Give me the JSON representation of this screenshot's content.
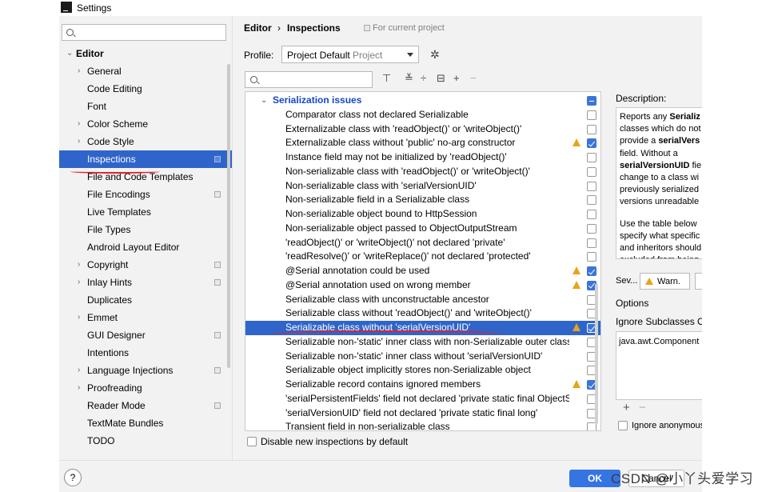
{
  "window": {
    "title": "Settings"
  },
  "sidebar": {
    "search_placeholder": "",
    "items": [
      {
        "label": "Editor",
        "expanded": true,
        "arrow": "open",
        "level": 0,
        "project": false
      },
      {
        "label": "General",
        "arrow": "closed",
        "level": 1,
        "project": false
      },
      {
        "label": "Code Editing",
        "arrow": "none",
        "level": 1,
        "project": false
      },
      {
        "label": "Font",
        "arrow": "none",
        "level": 1,
        "project": false
      },
      {
        "label": "Color Scheme",
        "arrow": "closed",
        "level": 1,
        "project": false
      },
      {
        "label": "Code Style",
        "arrow": "closed",
        "level": 1,
        "project": false
      },
      {
        "label": "Inspections",
        "arrow": "none",
        "level": 1,
        "project": true,
        "selected": true
      },
      {
        "label": "File and Code Templates",
        "arrow": "none",
        "level": 1,
        "project": false
      },
      {
        "label": "File Encodings",
        "arrow": "none",
        "level": 1,
        "project": true
      },
      {
        "label": "Live Templates",
        "arrow": "none",
        "level": 1,
        "project": false
      },
      {
        "label": "File Types",
        "arrow": "none",
        "level": 1,
        "project": false
      },
      {
        "label": "Android Layout Editor",
        "arrow": "none",
        "level": 1,
        "project": false
      },
      {
        "label": "Copyright",
        "arrow": "closed",
        "level": 1,
        "project": true
      },
      {
        "label": "Inlay Hints",
        "arrow": "closed",
        "level": 1,
        "project": true
      },
      {
        "label": "Duplicates",
        "arrow": "none",
        "level": 1,
        "project": false
      },
      {
        "label": "Emmet",
        "arrow": "closed",
        "level": 1,
        "project": false
      },
      {
        "label": "GUI Designer",
        "arrow": "none",
        "level": 1,
        "project": true
      },
      {
        "label": "Intentions",
        "arrow": "none",
        "level": 1,
        "project": false
      },
      {
        "label": "Language Injections",
        "arrow": "closed",
        "level": 1,
        "project": true
      },
      {
        "label": "Proofreading",
        "arrow": "closed",
        "level": 1,
        "project": false
      },
      {
        "label": "Reader Mode",
        "arrow": "none",
        "level": 1,
        "project": true
      },
      {
        "label": "TextMate Bundles",
        "arrow": "none",
        "level": 1,
        "project": false
      },
      {
        "label": "TODO",
        "arrow": "none",
        "level": 1,
        "project": false
      }
    ]
  },
  "breadcrumb": {
    "part1": "Editor",
    "sep": "›",
    "part2": "Inspections",
    "scope": "For current project"
  },
  "profile": {
    "label": "Profile:",
    "value": "Project Default",
    "tag": "Project"
  },
  "inspections": {
    "search_placeholder": "",
    "group": "Serialization issues",
    "rows": [
      {
        "label": "Comparator class not declared Serializable",
        "warn": false,
        "checked": false
      },
      {
        "label": "Externalizable class with 'readObject()' or 'writeObject()'",
        "warn": false,
        "checked": false
      },
      {
        "label": "Externalizable class without 'public' no-arg constructor",
        "warn": true,
        "checked": true
      },
      {
        "label": "Instance field may not be initialized by 'readObject()'",
        "warn": false,
        "checked": false
      },
      {
        "label": "Non-serializable class with 'readObject()' or 'writeObject()'",
        "warn": false,
        "checked": false
      },
      {
        "label": "Non-serializable class with 'serialVersionUID'",
        "warn": false,
        "checked": false
      },
      {
        "label": "Non-serializable field in a Serializable class",
        "warn": false,
        "checked": false
      },
      {
        "label": "Non-serializable object bound to HttpSession",
        "warn": false,
        "checked": false
      },
      {
        "label": "Non-serializable object passed to ObjectOutputStream",
        "warn": false,
        "checked": false
      },
      {
        "label": "'readObject()' or 'writeObject()' not declared 'private'",
        "warn": false,
        "checked": false
      },
      {
        "label": "'readResolve()' or 'writeReplace()' not declared 'protected'",
        "warn": false,
        "checked": false
      },
      {
        "label": "@Serial annotation could be used",
        "warn": true,
        "checked": true
      },
      {
        "label": "@Serial annotation used on wrong member",
        "warn": true,
        "checked": true
      },
      {
        "label": "Serializable class with unconstructable ancestor",
        "warn": false,
        "checked": false
      },
      {
        "label": "Serializable class without 'readObject()' and 'writeObject()'",
        "warn": false,
        "checked": false
      },
      {
        "label": "Serializable class without 'serialVersionUID'",
        "warn": true,
        "checked": true,
        "selected": true
      },
      {
        "label": "Serializable non-'static' inner class with non-Serializable outer class",
        "warn": false,
        "checked": false
      },
      {
        "label": "Serializable non-'static' inner class without 'serialVersionUID'",
        "warn": false,
        "checked": false
      },
      {
        "label": "Serializable object implicitly stores non-Serializable object",
        "warn": false,
        "checked": false
      },
      {
        "label": "Serializable record contains ignored members",
        "warn": true,
        "checked": true
      },
      {
        "label": "'serialPersistentFields' field not declared 'private static final ObjectStr",
        "warn": false,
        "checked": false
      },
      {
        "label": "'serialVersionUID' field not declared 'private static final long'",
        "warn": false,
        "checked": false
      },
      {
        "label": "Transient field in non-serializable class",
        "warn": false,
        "checked": false
      }
    ],
    "disable_new_label": "Disable new inspections by default"
  },
  "details": {
    "description_label": "Description:",
    "description_lines": [
      [
        "Reports any ",
        "Serializ",
        ""
      ],
      [
        "classes which do not",
        "",
        ""
      ],
      [
        "provide a ",
        "serialVers",
        ""
      ],
      [
        "field. Without a",
        "",
        ""
      ],
      [
        "",
        "serialVersionUID",
        " fie"
      ],
      [
        "change to a class wi",
        "",
        ""
      ],
      [
        "previously serialized",
        "",
        ""
      ],
      [
        "versions unreadable",
        "",
        ""
      ]
    ],
    "description_lines2": [
      "Use the table below",
      "specify what specific",
      "and inheritors should",
      "excluded from being"
    ],
    "severity_label": "Sev...",
    "severity_value": "Warn.",
    "options_label": "Options",
    "ignore_label": "Ignore Subclasses Of",
    "ignore_items": [
      "java.awt.Component"
    ],
    "anonymous_label": "Ignore anonymous"
  },
  "buttons": {
    "help": "?",
    "ok": "OK",
    "cancel": "Cancel"
  },
  "watermark": "CSDN @小丫头爱学习",
  "colors": {
    "selection": "#2f65ca",
    "group_text": "#1448c8",
    "warning": "#e8a318",
    "ok_button": "#3574e3",
    "annotation": "#e0212f"
  }
}
